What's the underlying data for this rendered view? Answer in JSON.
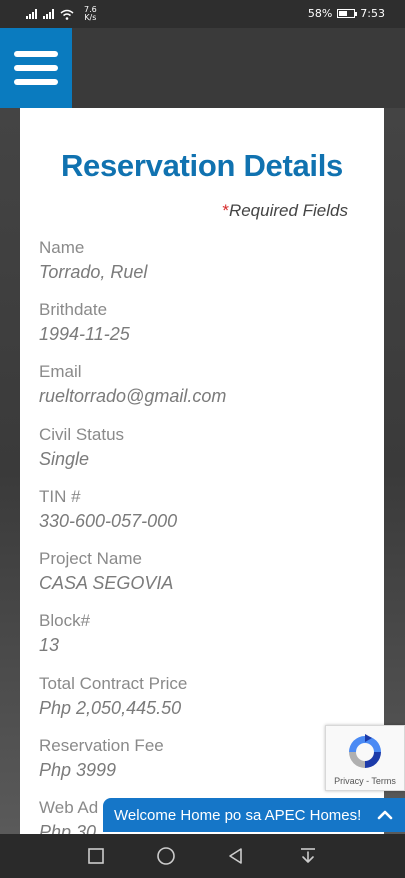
{
  "status": {
    "net_speed_value": "7.6",
    "net_speed_unit": "K/s",
    "battery": "58%",
    "battery_level": 0.58,
    "time": "7:53"
  },
  "header": {
    "menu_icon": "hamburger-menu-icon"
  },
  "form": {
    "title": "Reservation Details",
    "required_star": "*",
    "required_text": "Required Fields",
    "fields": [
      {
        "label": "Name",
        "value": "Torrado, Ruel"
      },
      {
        "label": "Brithdate",
        "value": "1994-11-25"
      },
      {
        "label": "Email",
        "value": "rueltorrado@gmail.com"
      },
      {
        "label": "Civil Status",
        "value": "Single"
      },
      {
        "label": "TIN #",
        "value": "330-600-057-000"
      },
      {
        "label": "Project Name",
        "value": "CASA SEGOVIA"
      },
      {
        "label": "Block#",
        "value": "13"
      },
      {
        "label": "Total Contract Price",
        "value": "Php 2,050,445.50"
      },
      {
        "label": "Reservation Fee",
        "value": "Php 3999"
      },
      {
        "label": "Web Ad",
        "value": "Php 30"
      }
    ]
  },
  "recaptcha": {
    "links": "Privacy - Terms"
  },
  "chat": {
    "text": "Welcome Home po sa APEC Homes!",
    "icon": "chevron-up-icon"
  },
  "colors": {
    "accent": "#0a7bbf",
    "title": "#1072b0",
    "required_star": "#d62828",
    "chat": "#1576c8"
  }
}
